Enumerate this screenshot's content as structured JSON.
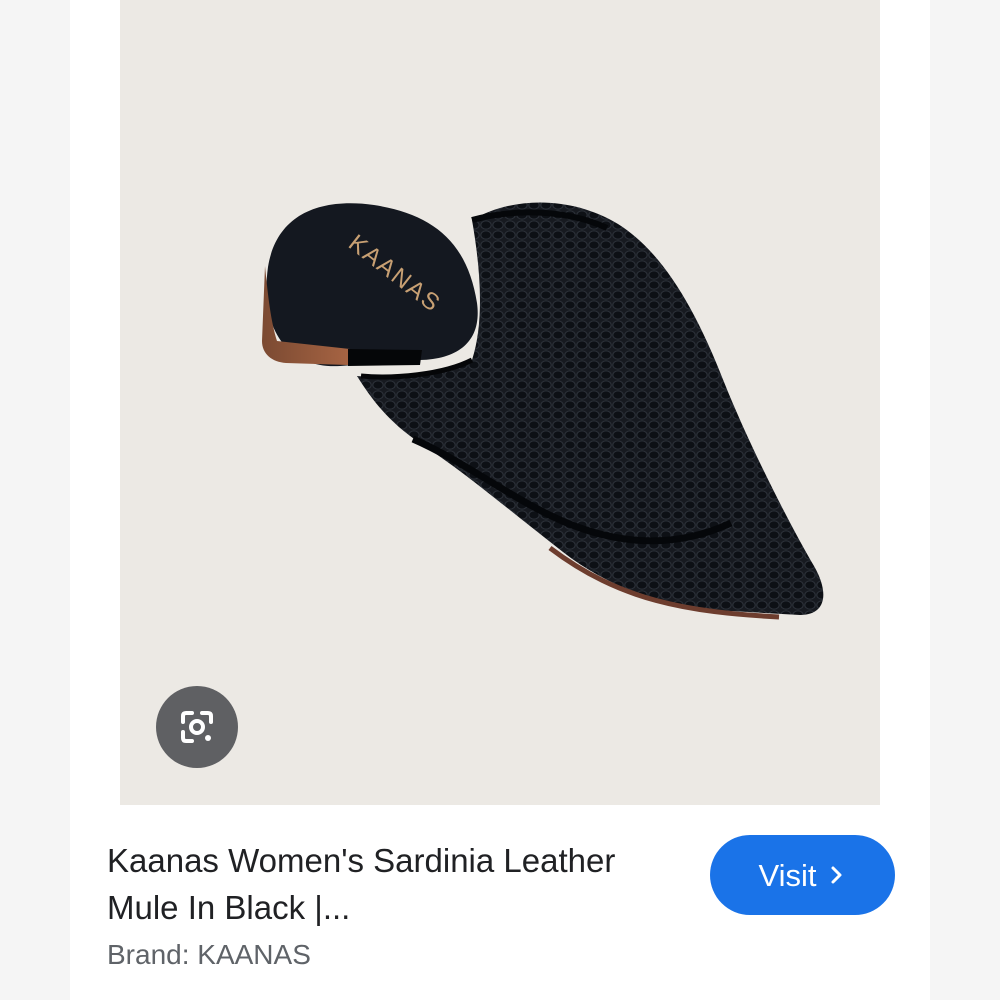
{
  "product": {
    "image_alt_brand_mark": "KAANAS",
    "title": "Kaanas Women's Sardinia Leather Mule In Black |...",
    "brand": "Brand: KAANAS"
  },
  "actions": {
    "visit_label": "Visit",
    "visit_icon": "chevron-right-icon",
    "lens_icon": "lens-icon"
  },
  "colors": {
    "accent": "#1a73e8",
    "lens_bg": "#5f6063",
    "image_bg": "#ece9e4",
    "title_text": "#202124",
    "brand_text": "#5f6368"
  }
}
